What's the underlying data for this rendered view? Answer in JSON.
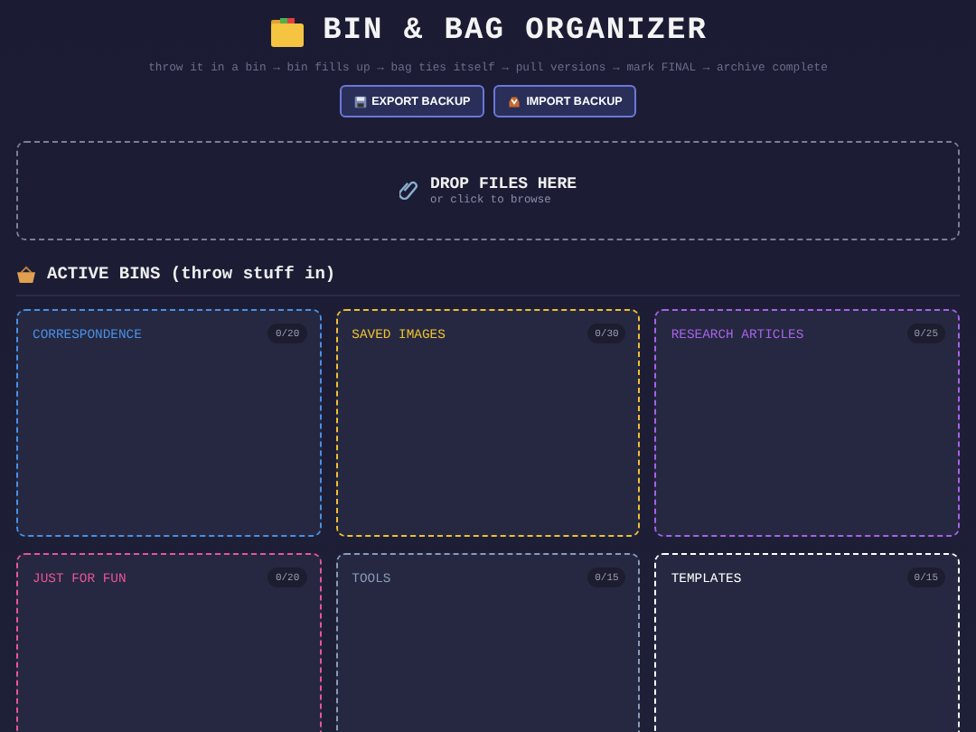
{
  "header": {
    "title": "BIN & BAG ORGANIZER",
    "subtitle": "throw it in a bin → bin fills up → bag ties itself → pull versions → mark FINAL → archive complete",
    "buttons": [
      {
        "kind": "export",
        "label": "EXPORT BACKUP"
      },
      {
        "kind": "import",
        "label": "IMPORT BACKUP"
      }
    ]
  },
  "drop_zone": {
    "title": "DROP FILES HERE",
    "hint": "or click to browse"
  },
  "section": {
    "title": "ACTIVE BINS (throw stuff in)"
  },
  "bins": [
    {
      "name": "CORRESPONDENCE",
      "count": "0/20",
      "color": "#4a8fe6"
    },
    {
      "name": "SAVED IMAGES",
      "count": "0/30",
      "color": "#f0c030"
    },
    {
      "name": "RESEARCH ARTICLES",
      "count": "0/25",
      "color": "#a862e8"
    },
    {
      "name": "JUST FOR FUN",
      "count": "0/20",
      "color": "#e8559a"
    },
    {
      "name": "TOOLS",
      "count": "0/15",
      "color": "#8a9ab8"
    },
    {
      "name": "TEMPLATES",
      "count": "0/15",
      "color": "#ffffff"
    }
  ]
}
